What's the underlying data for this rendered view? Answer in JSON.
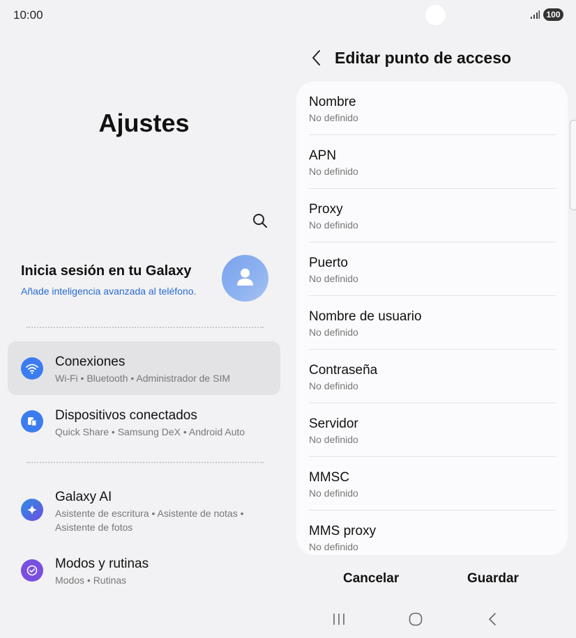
{
  "status_bar": {
    "time": "10:00",
    "battery": "100"
  },
  "left": {
    "title": "Ajustes",
    "account": {
      "title": "Inicia sesión en tu Galaxy",
      "subtitle": "Añade inteligencia avanzada al teléfono."
    },
    "items": [
      {
        "title": "Conexiones",
        "subtitle": "Wi-Fi • Bluetooth • Administrador de SIM",
        "icon": "wifi-icon",
        "color": "#3b7cf0"
      },
      {
        "title": "Dispositivos conectados",
        "subtitle": "Quick Share • Samsung DeX • Android Auto",
        "icon": "devices-icon",
        "color": "#3b7cf0"
      },
      {
        "title": "Galaxy AI",
        "subtitle": "Asistente de escritura • Asistente de notas • Asistente de fotos",
        "icon": "sparkle-icon",
        "color": "#4b6ee8"
      },
      {
        "title": "Modos y rutinas",
        "subtitle": "Modos • Rutinas",
        "icon": "check-circle-icon",
        "color": "#7a4fe0"
      }
    ]
  },
  "right": {
    "title": "Editar punto de acceso",
    "fields": [
      {
        "label": "Nombre",
        "value": "No definido"
      },
      {
        "label": "APN",
        "value": "No definido"
      },
      {
        "label": "Proxy",
        "value": "No definido"
      },
      {
        "label": "Puerto",
        "value": "No definido"
      },
      {
        "label": "Nombre de usuario",
        "value": "No definido"
      },
      {
        "label": "Contraseña",
        "value": "No definido"
      },
      {
        "label": "Servidor",
        "value": "No definido"
      },
      {
        "label": "MMSC",
        "value": "No definido"
      },
      {
        "label": "MMS proxy",
        "value": "No definido"
      }
    ],
    "cancel_label": "Cancelar",
    "save_label": "Guardar"
  }
}
